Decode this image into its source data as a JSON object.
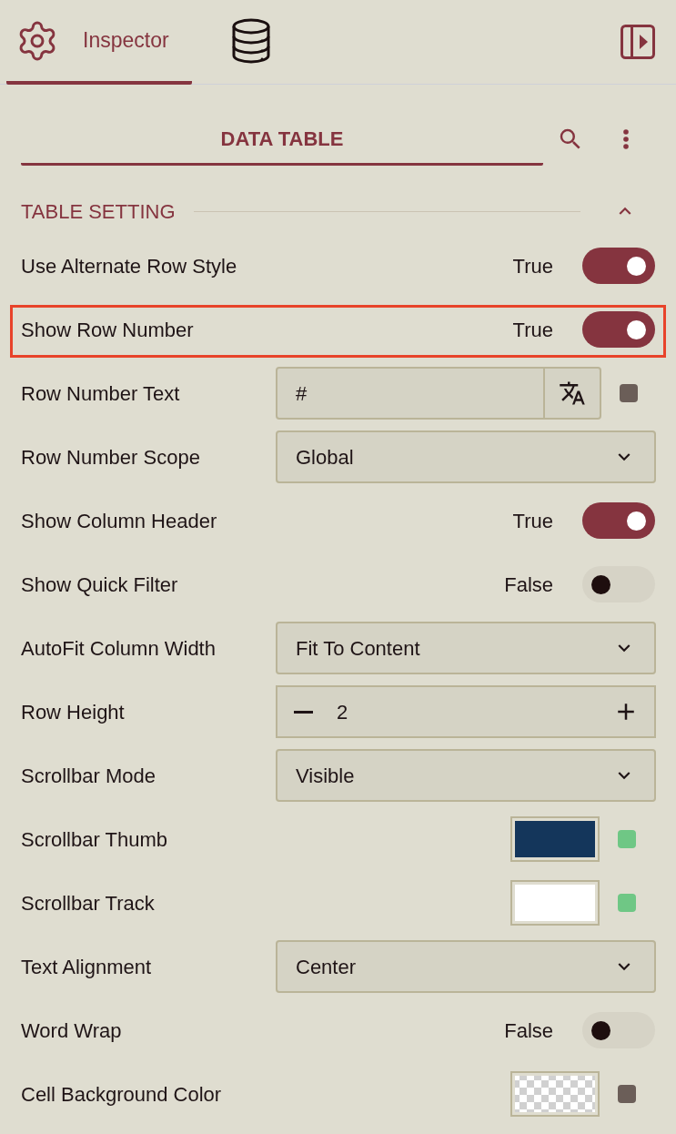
{
  "tabs": [
    {
      "label": "Inspector",
      "selected": true
    },
    {
      "selected": false
    }
  ],
  "header": {
    "title": "DATA TABLE"
  },
  "section": {
    "title": "TABLE SETTING",
    "expanded": true
  },
  "rows": [
    {
      "kind": "toggle",
      "label": "Use Alternate Row Style",
      "value": "True",
      "on": true,
      "highlighted": false
    },
    {
      "kind": "toggle",
      "label": "Show Row Number",
      "value": "True",
      "on": true,
      "highlighted": true
    },
    {
      "kind": "text",
      "label": "Row Number Text",
      "value": "#",
      "color": "#6b5e58",
      "highlighted": false
    },
    {
      "kind": "select",
      "label": "Row Number Scope",
      "value": "Global",
      "highlighted": false
    },
    {
      "kind": "toggle",
      "label": "Show Column Header",
      "value": "True",
      "on": true,
      "highlighted": false
    },
    {
      "kind": "toggle",
      "label": "Show Quick Filter",
      "value": "False",
      "on": false,
      "highlighted": false
    },
    {
      "kind": "select",
      "label": "AutoFit Column Width",
      "value": "Fit To Content",
      "highlighted": false
    },
    {
      "kind": "stepper",
      "label": "Row Height",
      "value": "2",
      "highlighted": false
    },
    {
      "kind": "select",
      "label": "Scrollbar Mode",
      "value": "Visible",
      "highlighted": false
    },
    {
      "kind": "color",
      "label": "Scrollbar Thumb",
      "swatch": {
        "color": "#14365b"
      },
      "transparent": false,
      "color": "#6fc785",
      "highlighted": false
    },
    {
      "kind": "color",
      "label": "Scrollbar Track",
      "swatch": {
        "color": "#ffffff"
      },
      "transparent": false,
      "color": "#6fc785",
      "highlighted": false
    },
    {
      "kind": "select",
      "label": "Text Alignment",
      "value": "Center",
      "highlighted": false
    },
    {
      "kind": "toggle",
      "label": "Word Wrap",
      "value": "False",
      "on": false,
      "highlighted": false
    },
    {
      "kind": "color",
      "label": "Cell Background Color",
      "transparent": true,
      "color": "#6b5e58",
      "highlighted": false
    }
  ]
}
